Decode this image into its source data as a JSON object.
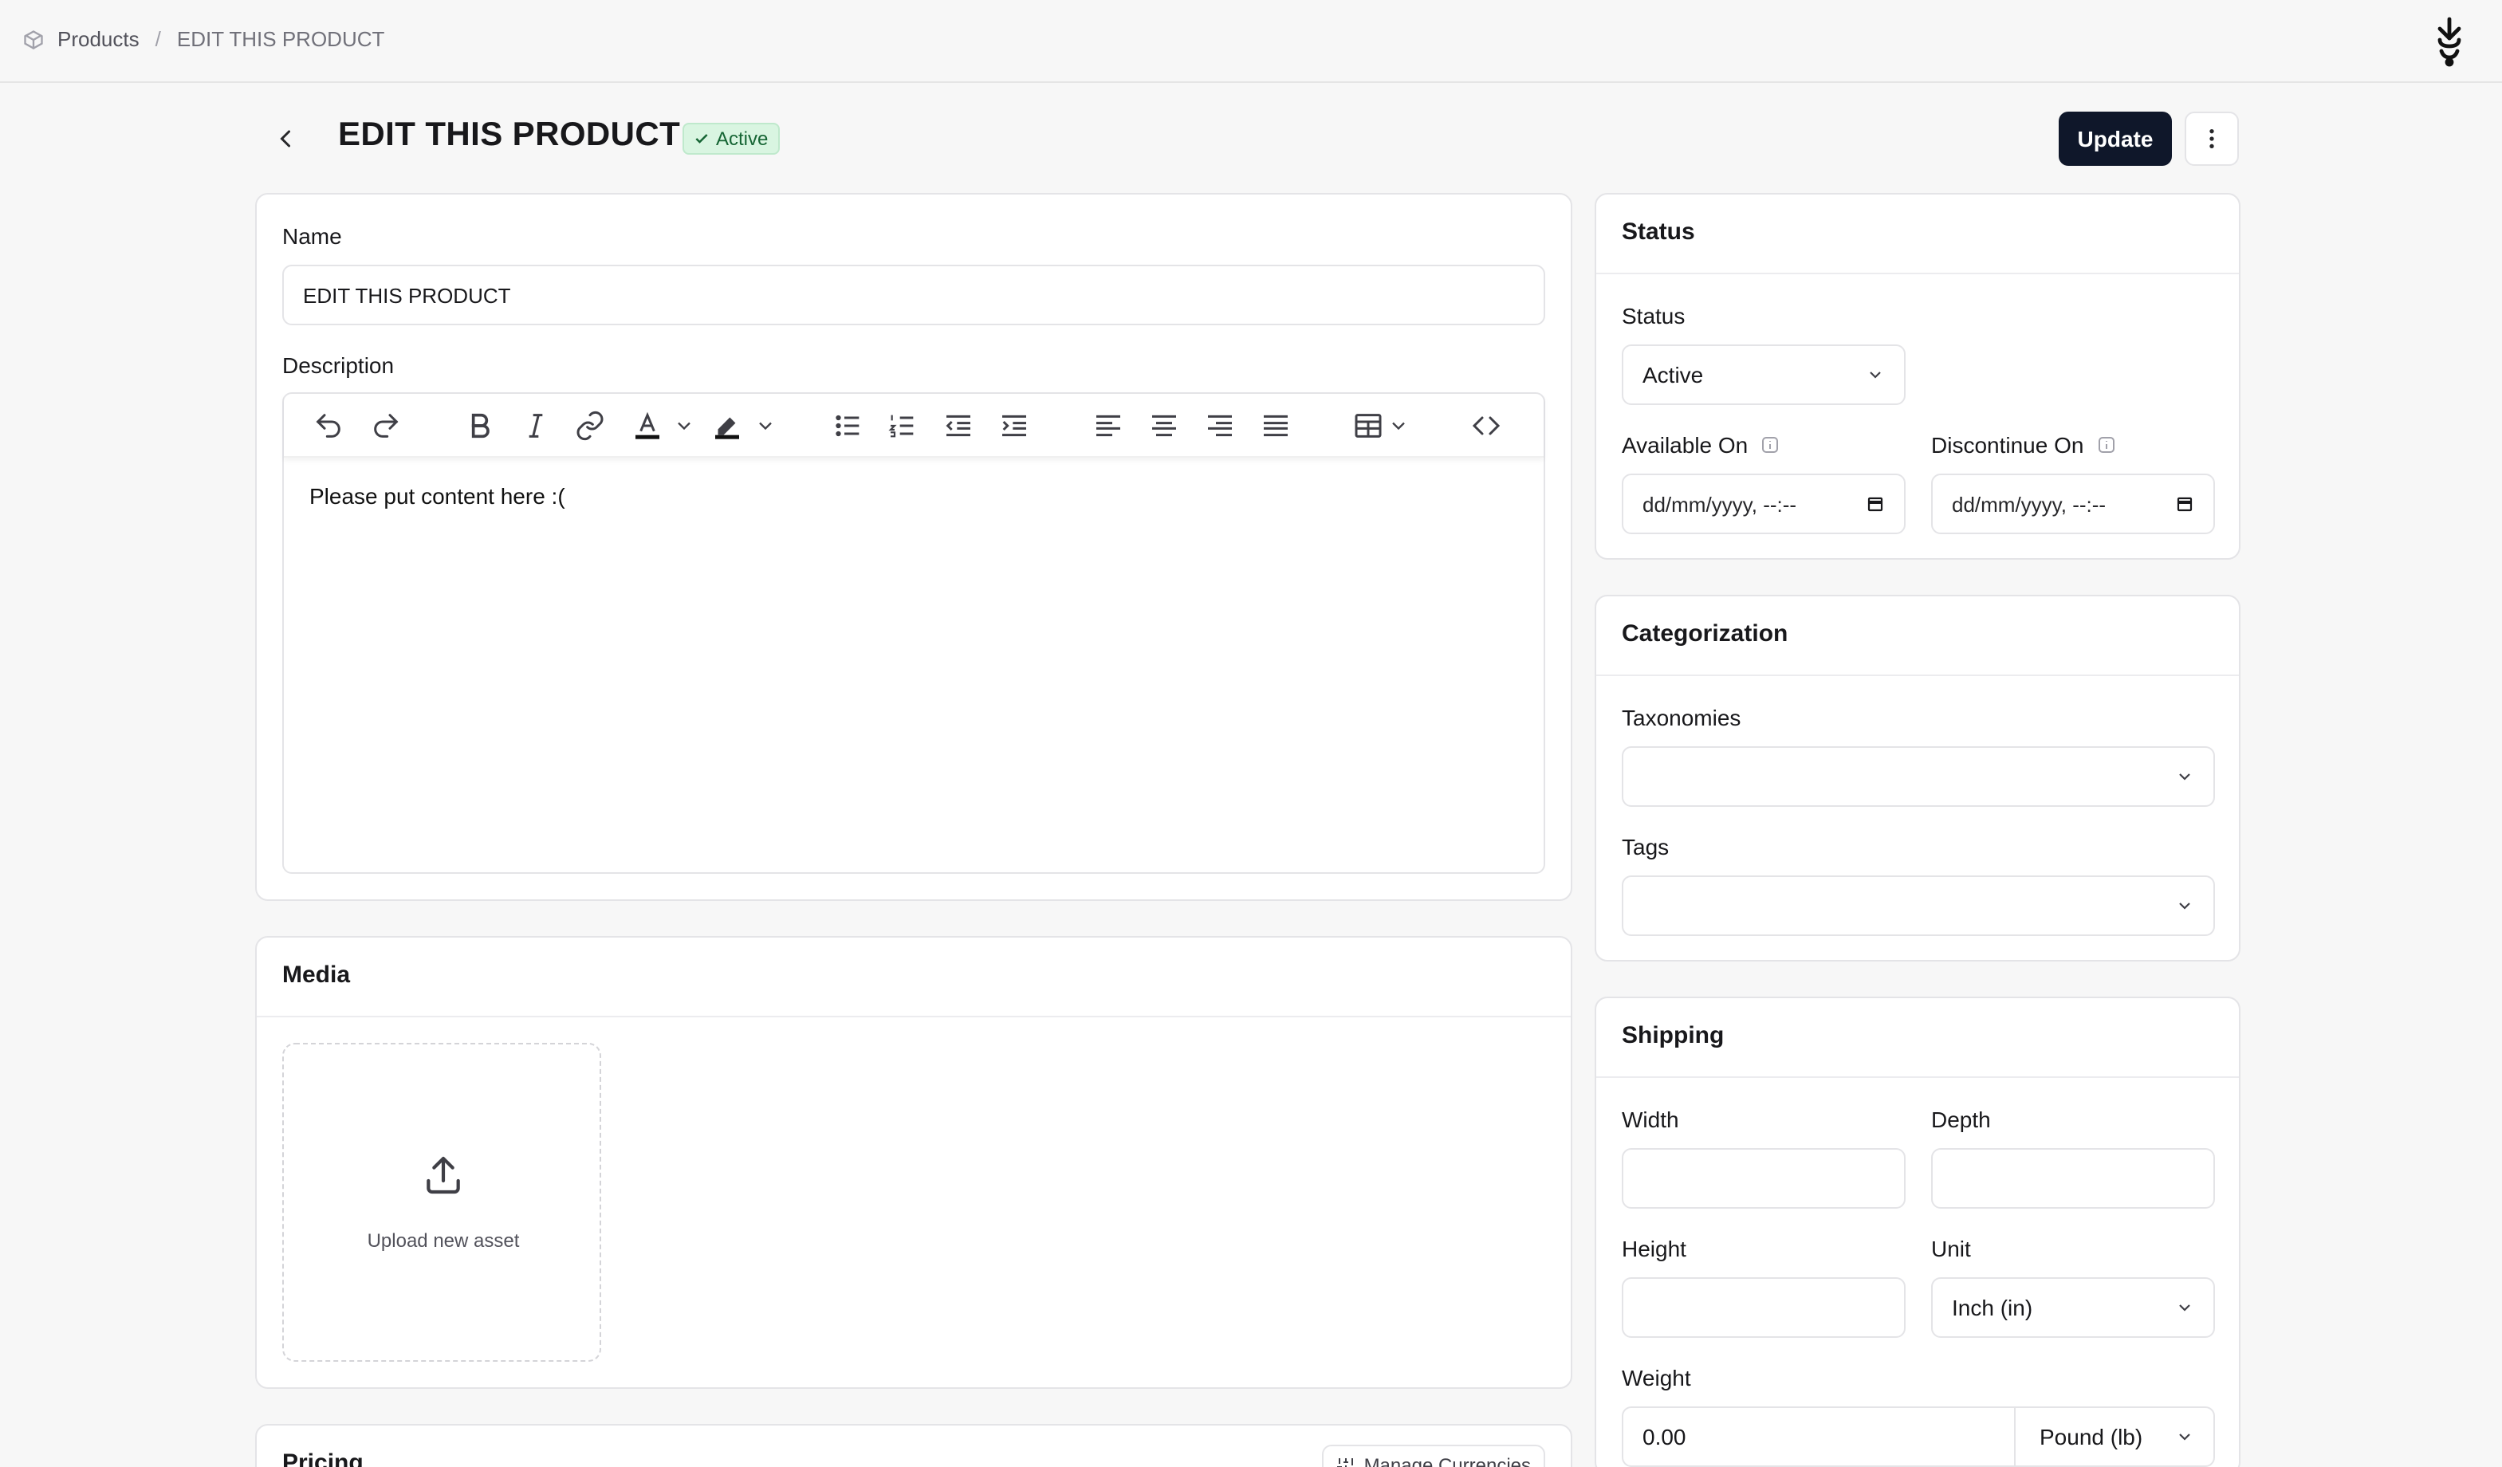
{
  "breadcrumb": {
    "root": "Products",
    "separator": "/",
    "current": "EDIT THIS PRODUCT"
  },
  "header": {
    "title": "EDIT THIS PRODUCT",
    "status_badge": "Active",
    "update_label": "Update"
  },
  "general": {
    "name_label": "Name",
    "name_value": "EDIT THIS PRODUCT",
    "description_label": "Description",
    "description_content": "Please put content here :("
  },
  "media": {
    "title": "Media",
    "upload_label": "Upload new asset"
  },
  "pricing": {
    "title": "Pricing",
    "manage_label": "Manage Currencies"
  },
  "status_card": {
    "title": "Status",
    "status_label": "Status",
    "status_value": "Active",
    "available_label": "Available On",
    "available_value": "dd/mm/yyyy, --:--",
    "discontinue_label": "Discontinue On",
    "discontinue_value": "dd/mm/yyyy, --:--"
  },
  "categorization": {
    "title": "Categorization",
    "taxonomies_label": "Taxonomies",
    "tags_label": "Tags"
  },
  "shipping": {
    "title": "Shipping",
    "width_label": "Width",
    "depth_label": "Depth",
    "height_label": "Height",
    "unit_label": "Unit",
    "unit_value": "Inch (in)",
    "weight_label": "Weight",
    "weight_value": "0.00",
    "weight_unit": "Pound (lb)"
  },
  "colors": {
    "primary_button": "#0f172a",
    "badge_bg": "#d9f5e1",
    "badge_text": "#166534"
  }
}
